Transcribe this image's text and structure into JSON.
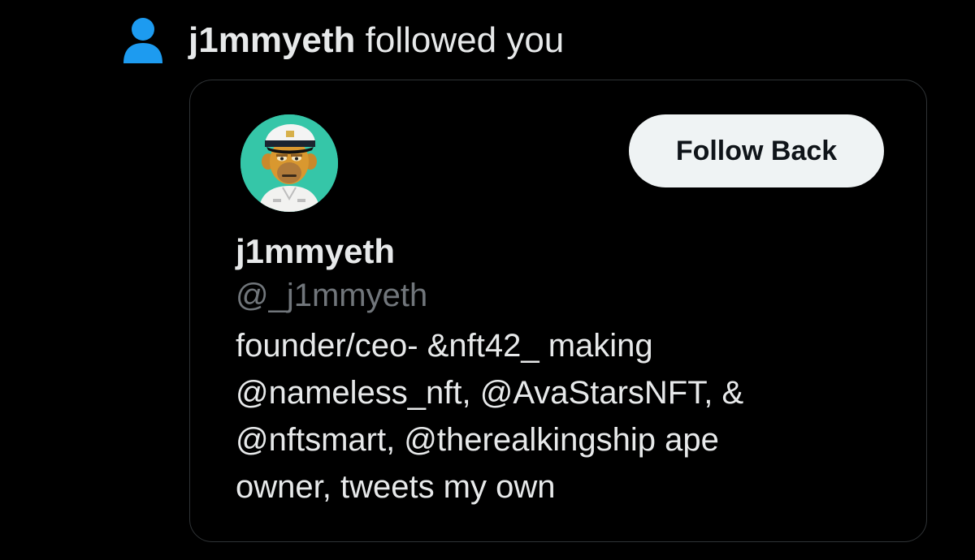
{
  "notification": {
    "icon": "person-icon",
    "username": "j1mmyeth",
    "action_text": "followed you"
  },
  "profile_card": {
    "avatar": "bored-ape-avatar",
    "follow_button_label": "Follow Back",
    "display_name": "j1mmyeth",
    "handle": "@_j1mmyeth",
    "bio_lines": [
      "founder/ceo- &nft42_ making",
      "@nameless_nft, @AvaStarsNFT, &",
      "@nftsmart, @therealkingship ape",
      "owner, tweets my own"
    ]
  },
  "colors": {
    "background": "#000000",
    "accent_blue": "#1d9bf0",
    "primary_text": "#e7e9ea",
    "secondary_text": "#71767b",
    "card_border": "#2f3336",
    "button_bg": "#eff3f4",
    "avatar_bg": "#35c6a8"
  }
}
